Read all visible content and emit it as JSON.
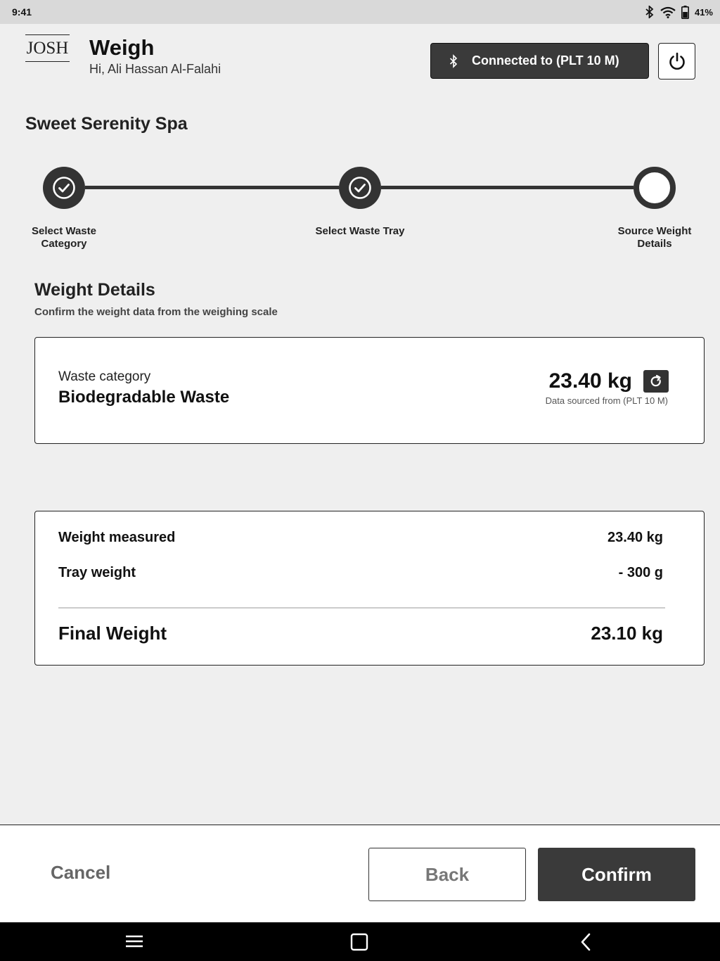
{
  "status_bar": {
    "time": "9:41",
    "battery": "41%",
    "icons": [
      "bluetooth-icon",
      "wifi-icon",
      "battery-icon"
    ]
  },
  "header": {
    "logo": "JOSH",
    "title": "Weigh",
    "greeting": "Hi, Ali Hassan Al-Falahi",
    "connection_label": "Connected to (PLT 10 M)",
    "icons": [
      "bluetooth-icon",
      "power-icon"
    ]
  },
  "venue": "Sweet Serenity Spa",
  "stepper": {
    "steps": [
      {
        "label": "Select Waste Category",
        "status": "done"
      },
      {
        "label": "Select Waste Tray",
        "status": "done"
      },
      {
        "label": "Source Weight Details",
        "status": "current"
      }
    ]
  },
  "weight_details": {
    "title": "Weight Details",
    "subtitle": "Confirm the weight data from the weighing scale",
    "category_label": "Waste category",
    "category_value": "Biodegradable Waste",
    "weight": "23.40 kg",
    "source_note": "Data sourced from (PLT 10 M)"
  },
  "summary": {
    "rows": [
      {
        "label": "Weight measured",
        "value": "23.40 kg"
      },
      {
        "label": "Tray weight",
        "value": "- 300 g"
      }
    ],
    "final_label": "Final Weight",
    "final_value": "23.10 kg"
  },
  "footer": {
    "cancel": "Cancel",
    "back": "Back",
    "confirm": "Confirm"
  },
  "nav_bar": {
    "icons": [
      "menu-icon",
      "home-icon",
      "back-icon"
    ]
  },
  "colors": {
    "dark": "#3a3a3a",
    "background": "#efefef",
    "card": "#ffffff"
  }
}
